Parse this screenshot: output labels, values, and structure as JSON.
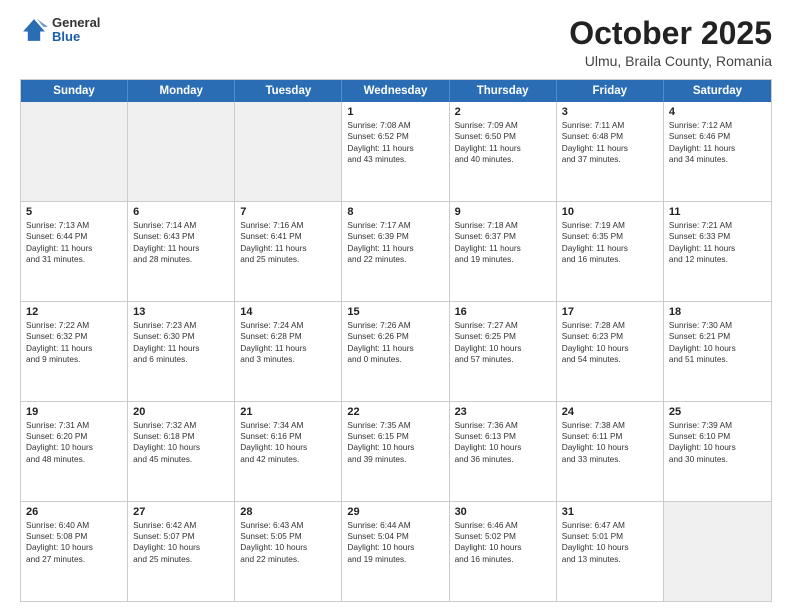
{
  "header": {
    "logo_general": "General",
    "logo_blue": "Blue",
    "month_title": "October 2025",
    "location": "Ulmu, Braila County, Romania"
  },
  "calendar": {
    "days_of_week": [
      "Sunday",
      "Monday",
      "Tuesday",
      "Wednesday",
      "Thursday",
      "Friday",
      "Saturday"
    ],
    "rows": [
      [
        {
          "day": "",
          "lines": [],
          "shaded": true
        },
        {
          "day": "",
          "lines": [],
          "shaded": true
        },
        {
          "day": "",
          "lines": [],
          "shaded": true
        },
        {
          "day": "1",
          "lines": [
            "Sunrise: 7:08 AM",
            "Sunset: 6:52 PM",
            "Daylight: 11 hours",
            "and 43 minutes."
          ]
        },
        {
          "day": "2",
          "lines": [
            "Sunrise: 7:09 AM",
            "Sunset: 6:50 PM",
            "Daylight: 11 hours",
            "and 40 minutes."
          ]
        },
        {
          "day": "3",
          "lines": [
            "Sunrise: 7:11 AM",
            "Sunset: 6:48 PM",
            "Daylight: 11 hours",
            "and 37 minutes."
          ]
        },
        {
          "day": "4",
          "lines": [
            "Sunrise: 7:12 AM",
            "Sunset: 6:46 PM",
            "Daylight: 11 hours",
            "and 34 minutes."
          ]
        }
      ],
      [
        {
          "day": "5",
          "lines": [
            "Sunrise: 7:13 AM",
            "Sunset: 6:44 PM",
            "Daylight: 11 hours",
            "and 31 minutes."
          ]
        },
        {
          "day": "6",
          "lines": [
            "Sunrise: 7:14 AM",
            "Sunset: 6:43 PM",
            "Daylight: 11 hours",
            "and 28 minutes."
          ]
        },
        {
          "day": "7",
          "lines": [
            "Sunrise: 7:16 AM",
            "Sunset: 6:41 PM",
            "Daylight: 11 hours",
            "and 25 minutes."
          ]
        },
        {
          "day": "8",
          "lines": [
            "Sunrise: 7:17 AM",
            "Sunset: 6:39 PM",
            "Daylight: 11 hours",
            "and 22 minutes."
          ]
        },
        {
          "day": "9",
          "lines": [
            "Sunrise: 7:18 AM",
            "Sunset: 6:37 PM",
            "Daylight: 11 hours",
            "and 19 minutes."
          ]
        },
        {
          "day": "10",
          "lines": [
            "Sunrise: 7:19 AM",
            "Sunset: 6:35 PM",
            "Daylight: 11 hours",
            "and 16 minutes."
          ]
        },
        {
          "day": "11",
          "lines": [
            "Sunrise: 7:21 AM",
            "Sunset: 6:33 PM",
            "Daylight: 11 hours",
            "and 12 minutes."
          ]
        }
      ],
      [
        {
          "day": "12",
          "lines": [
            "Sunrise: 7:22 AM",
            "Sunset: 6:32 PM",
            "Daylight: 11 hours",
            "and 9 minutes."
          ]
        },
        {
          "day": "13",
          "lines": [
            "Sunrise: 7:23 AM",
            "Sunset: 6:30 PM",
            "Daylight: 11 hours",
            "and 6 minutes."
          ]
        },
        {
          "day": "14",
          "lines": [
            "Sunrise: 7:24 AM",
            "Sunset: 6:28 PM",
            "Daylight: 11 hours",
            "and 3 minutes."
          ]
        },
        {
          "day": "15",
          "lines": [
            "Sunrise: 7:26 AM",
            "Sunset: 6:26 PM",
            "Daylight: 11 hours",
            "and 0 minutes."
          ]
        },
        {
          "day": "16",
          "lines": [
            "Sunrise: 7:27 AM",
            "Sunset: 6:25 PM",
            "Daylight: 10 hours",
            "and 57 minutes."
          ]
        },
        {
          "day": "17",
          "lines": [
            "Sunrise: 7:28 AM",
            "Sunset: 6:23 PM",
            "Daylight: 10 hours",
            "and 54 minutes."
          ]
        },
        {
          "day": "18",
          "lines": [
            "Sunrise: 7:30 AM",
            "Sunset: 6:21 PM",
            "Daylight: 10 hours",
            "and 51 minutes."
          ]
        }
      ],
      [
        {
          "day": "19",
          "lines": [
            "Sunrise: 7:31 AM",
            "Sunset: 6:20 PM",
            "Daylight: 10 hours",
            "and 48 minutes."
          ]
        },
        {
          "day": "20",
          "lines": [
            "Sunrise: 7:32 AM",
            "Sunset: 6:18 PM",
            "Daylight: 10 hours",
            "and 45 minutes."
          ]
        },
        {
          "day": "21",
          "lines": [
            "Sunrise: 7:34 AM",
            "Sunset: 6:16 PM",
            "Daylight: 10 hours",
            "and 42 minutes."
          ]
        },
        {
          "day": "22",
          "lines": [
            "Sunrise: 7:35 AM",
            "Sunset: 6:15 PM",
            "Daylight: 10 hours",
            "and 39 minutes."
          ]
        },
        {
          "day": "23",
          "lines": [
            "Sunrise: 7:36 AM",
            "Sunset: 6:13 PM",
            "Daylight: 10 hours",
            "and 36 minutes."
          ]
        },
        {
          "day": "24",
          "lines": [
            "Sunrise: 7:38 AM",
            "Sunset: 6:11 PM",
            "Daylight: 10 hours",
            "and 33 minutes."
          ]
        },
        {
          "day": "25",
          "lines": [
            "Sunrise: 7:39 AM",
            "Sunset: 6:10 PM",
            "Daylight: 10 hours",
            "and 30 minutes."
          ]
        }
      ],
      [
        {
          "day": "26",
          "lines": [
            "Sunrise: 6:40 AM",
            "Sunset: 5:08 PM",
            "Daylight: 10 hours",
            "and 27 minutes."
          ]
        },
        {
          "day": "27",
          "lines": [
            "Sunrise: 6:42 AM",
            "Sunset: 5:07 PM",
            "Daylight: 10 hours",
            "and 25 minutes."
          ]
        },
        {
          "day": "28",
          "lines": [
            "Sunrise: 6:43 AM",
            "Sunset: 5:05 PM",
            "Daylight: 10 hours",
            "and 22 minutes."
          ]
        },
        {
          "day": "29",
          "lines": [
            "Sunrise: 6:44 AM",
            "Sunset: 5:04 PM",
            "Daylight: 10 hours",
            "and 19 minutes."
          ]
        },
        {
          "day": "30",
          "lines": [
            "Sunrise: 6:46 AM",
            "Sunset: 5:02 PM",
            "Daylight: 10 hours",
            "and 16 minutes."
          ]
        },
        {
          "day": "31",
          "lines": [
            "Sunrise: 6:47 AM",
            "Sunset: 5:01 PM",
            "Daylight: 10 hours",
            "and 13 minutes."
          ]
        },
        {
          "day": "",
          "lines": [],
          "shaded": true
        }
      ]
    ]
  }
}
